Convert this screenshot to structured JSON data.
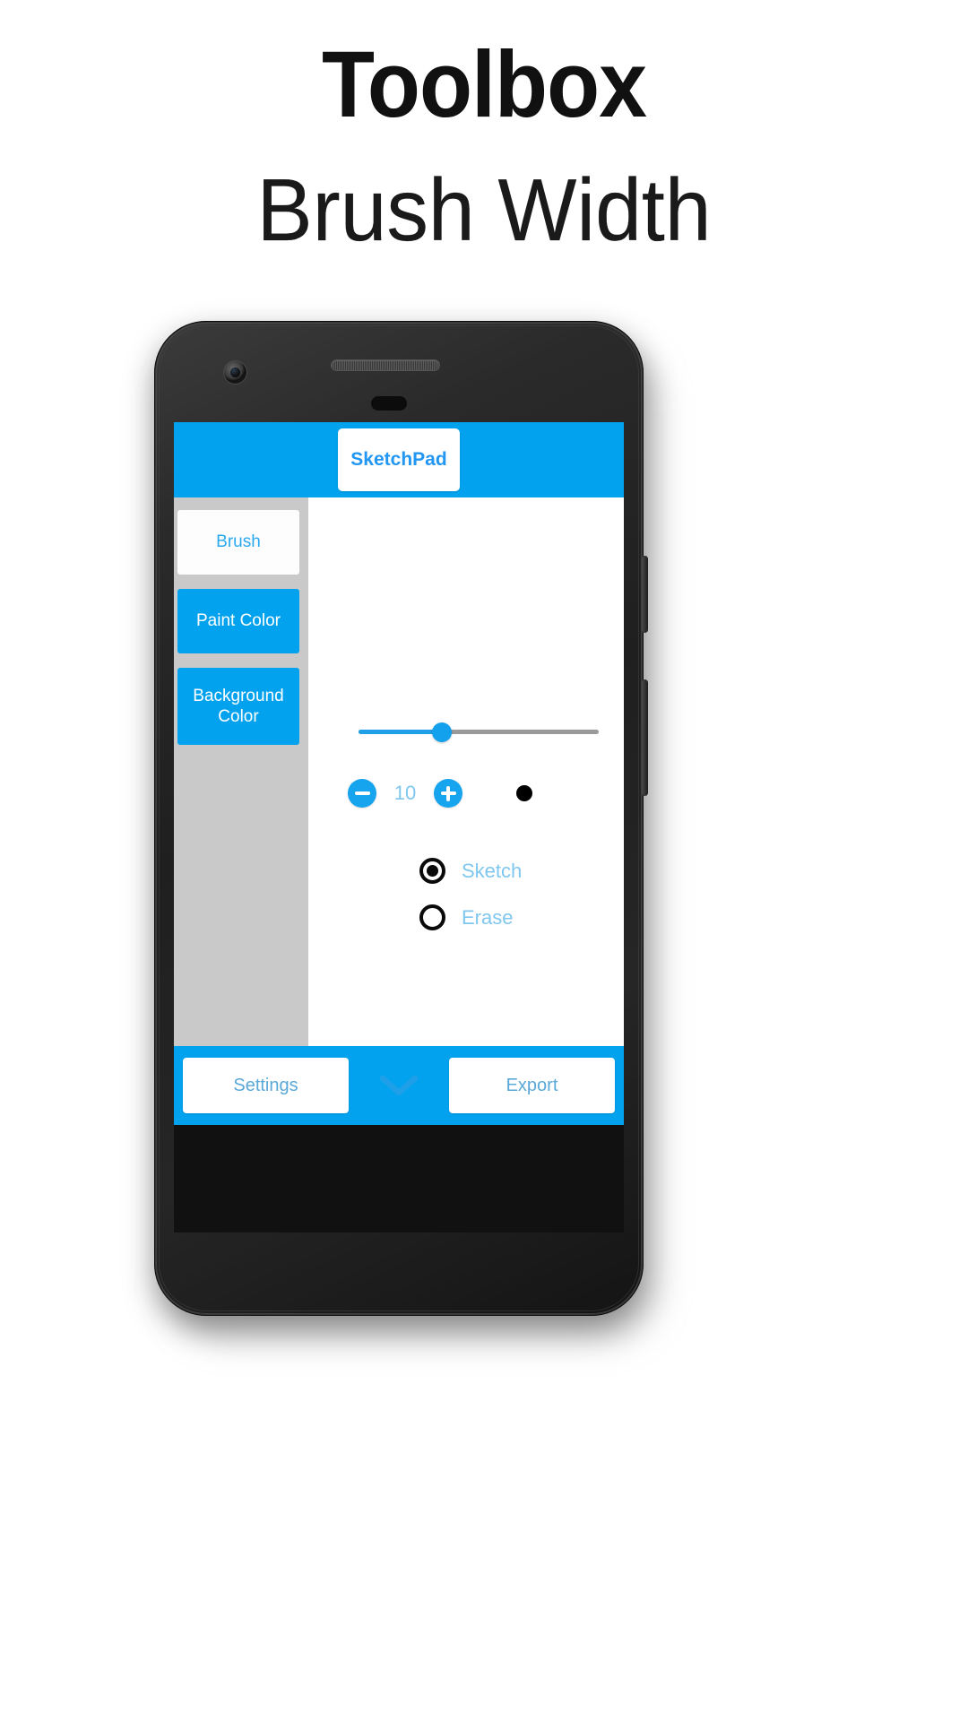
{
  "page": {
    "title": "Toolbox",
    "subtitle": "Brush Width"
  },
  "colors": {
    "accent_blue": "#03a2ee",
    "sidebar_gray": "#c9c9c9",
    "label_blue": "#7fc7ef",
    "brush_preview": "#000000",
    "slider_track": "#9a9a9a"
  },
  "app": {
    "appbar": {
      "button_label": "SketchPad"
    },
    "sidebar": {
      "items": [
        {
          "label": "Brush",
          "state": "active"
        },
        {
          "label": "Paint Color",
          "state": "default"
        },
        {
          "label": "Background Color",
          "state": "default"
        }
      ]
    },
    "brush_panel": {
      "slider": {
        "value": 10,
        "min": 1,
        "max": 30,
        "percent": 33
      },
      "stepper": {
        "decrement_label": "−",
        "value": "10",
        "increment_label": "+"
      },
      "preview": {
        "shape": "dot",
        "color": "#000000"
      },
      "modes": [
        {
          "label": "Sketch",
          "selected": true
        },
        {
          "label": "Erase",
          "selected": false
        }
      ]
    },
    "bottombar": {
      "settings_label": "Settings",
      "expand_icon": "chevron-down-icon",
      "export_label": "Export"
    }
  }
}
